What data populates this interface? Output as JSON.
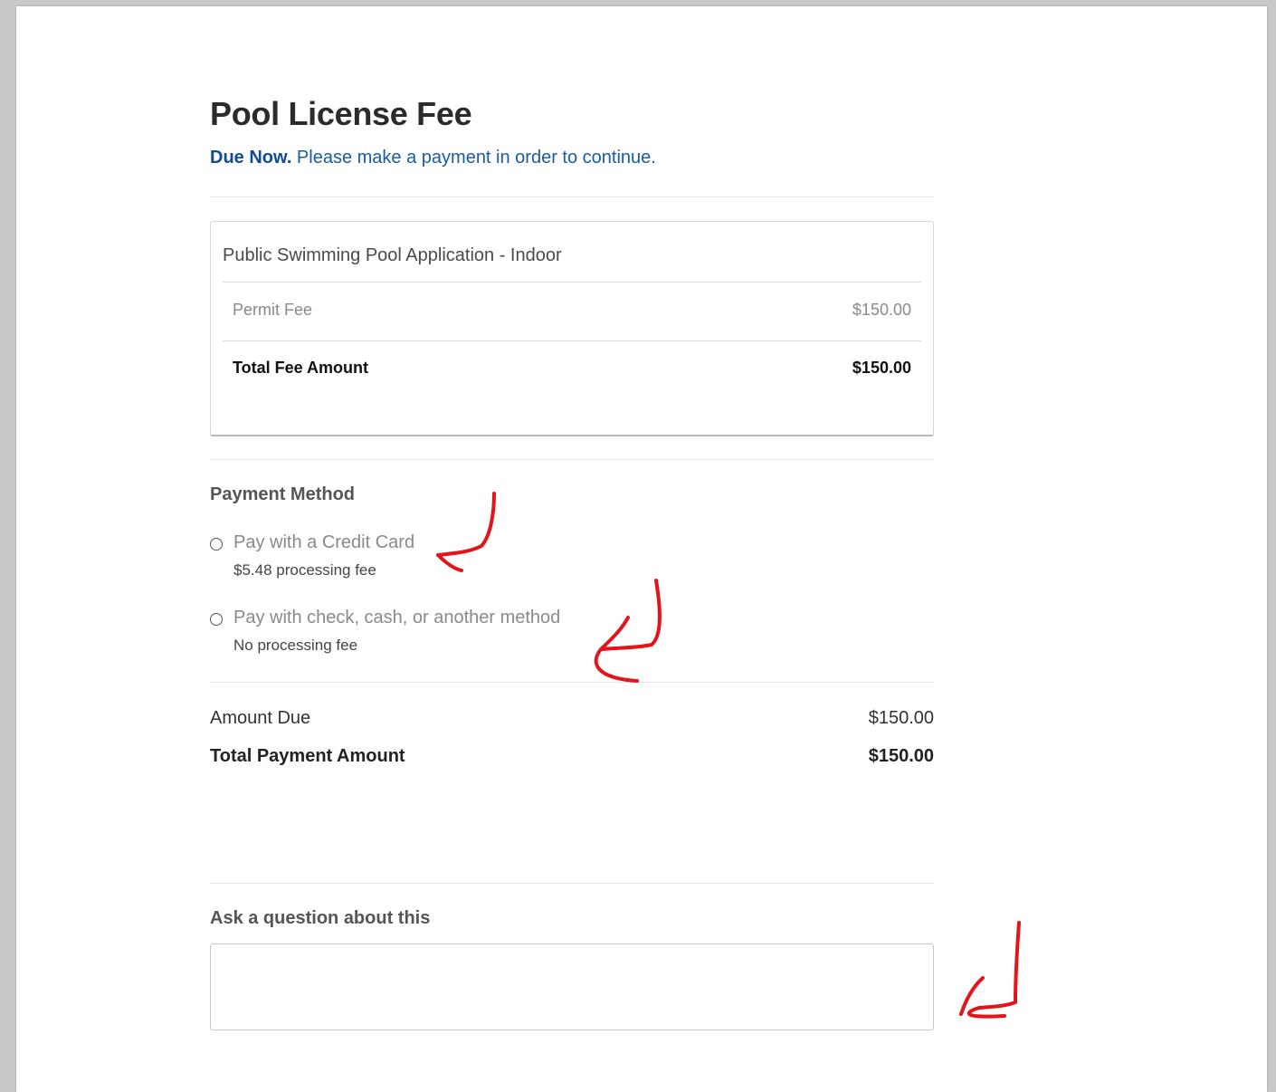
{
  "header": {
    "title": "Pool License Fee",
    "due_strong": "Due Now.",
    "due_text": " Please make a payment in order to continue."
  },
  "fee_card": {
    "title": "Public Swimming Pool Application - Indoor",
    "items": [
      {
        "label": "Permit Fee",
        "amount": "$150.00"
      }
    ],
    "total": {
      "label": "Total Fee Amount",
      "amount": "$150.00"
    }
  },
  "payment_method": {
    "heading": "Payment Method",
    "options": [
      {
        "label": "Pay with a Credit Card",
        "sub": "$5.48 processing fee",
        "selected": false
      },
      {
        "label": "Pay with check, cash, or another method",
        "sub": "No processing fee",
        "selected": false
      }
    ]
  },
  "summary": {
    "amount_due_label": "Amount Due",
    "amount_due": "$150.00",
    "total_label": "Total Payment Amount",
    "total": "$150.00"
  },
  "question": {
    "label": "Ask a question about this",
    "value": "",
    "placeholder": ""
  },
  "colors": {
    "accent": "#1a5ba3",
    "annotation": "#e3151b"
  }
}
